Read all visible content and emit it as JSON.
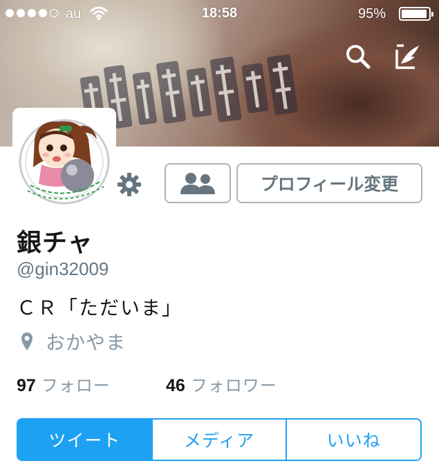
{
  "status_bar": {
    "carrier": "au",
    "time": "18:58",
    "battery_percent": "95%",
    "battery_level": 0.95,
    "signal_bars_filled": 4,
    "signal_bars_total": 5
  },
  "header": {
    "search_icon": "search-icon",
    "compose_icon": "compose-tweet-icon"
  },
  "profile": {
    "display_name": "銀チャ",
    "handle": "@gin32009",
    "bio": "ＣＲ「ただいま」",
    "location": "おかやま",
    "settings_icon": "gear-icon",
    "follow_list_icon": "people-icon",
    "edit_profile_label": "プロフィール変更"
  },
  "stats": {
    "following_count": "97",
    "following_label": "フォロー",
    "followers_count": "46",
    "followers_label": "フォロワー"
  },
  "tabs": [
    {
      "label": "ツイート",
      "active": true
    },
    {
      "label": "メディア",
      "active": false
    },
    {
      "label": "いいね",
      "active": false
    }
  ],
  "colors": {
    "accent": "#1da1f2",
    "text_primary": "#14171a",
    "text_secondary": "#657786",
    "text_muted": "#8899a6",
    "button_border": "#aab4be"
  }
}
